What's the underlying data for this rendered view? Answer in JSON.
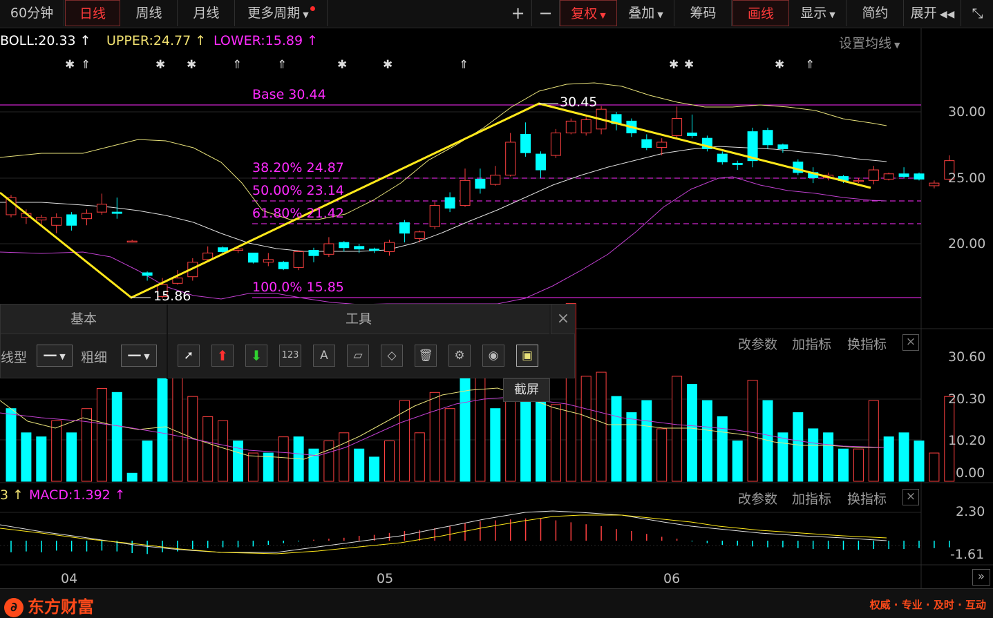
{
  "toolbar": {
    "period_60": "60分钟",
    "period_day": "日线",
    "period_week": "周线",
    "period_month": "月线",
    "more_periods": "更多周期",
    "zoom_in": "+",
    "zoom_out": "−",
    "restore_rights": "复权",
    "overlay": "叠加",
    "chips": "筹码",
    "draw": "画线",
    "display": "显示",
    "simple": "简约",
    "expand": "展开"
  },
  "boll": {
    "boll": "BOLL:20.33",
    "upper": "UPPER:24.77",
    "lower": "LOWER:15.89",
    "setting": "设置均线"
  },
  "annotations": {
    "base": "Base   30.44",
    "fib382": "38.20% 24.87",
    "fib500": "50.00% 23.14",
    "fib618": "61.80% 21.42",
    "fib1000": "100.0% 15.85",
    "high": "30.45",
    "low": "15.86"
  },
  "price_axis": [
    "30.00",
    "25.00",
    "20.00"
  ],
  "volume_axis": [
    "30.60",
    "20.30",
    "10.20",
    "0.00"
  ],
  "macd_axis": [
    "2.30",
    "-1.61"
  ],
  "date_axis": [
    "04",
    "05",
    "06"
  ],
  "panel_actions": {
    "modify": "改参数",
    "add": "加指标",
    "switch": "换指标",
    "close": "×"
  },
  "macd": {
    "left": "3",
    "macd": "MACD:1.392"
  },
  "draw_panel": {
    "tab_basic": "基本",
    "tab_tools": "工具",
    "line_type_label": "线型",
    "thickness_label": "粗细",
    "tool_123": "123",
    "tool_text": "A",
    "close": "×",
    "tooltip": "截屏"
  },
  "footer": {
    "logo": "东方财富",
    "slogan": "权威 · 专业 · 及时 · 互动"
  },
  "colors": {
    "up": "#ff4040",
    "down": "#00ffff",
    "fib": "#ff2bff",
    "trend": "#ffe81a",
    "upper": "#e8e27a",
    "mid": "#e0e0e0",
    "lower": "#c040d0"
  },
  "chart_data": {
    "type": "candlestick",
    "price_scale": {
      "y_top": 30.0,
      "y_bottom": 20.0
    },
    "candles": [
      [
        22.2,
        23.5,
        23.7,
        22.0
      ],
      [
        22.0,
        22.3,
        22.6,
        21.5
      ],
      [
        21.8,
        22.0,
        22.2,
        21.3
      ],
      [
        21.4,
        22.0,
        22.3,
        20.8
      ],
      [
        22.2,
        21.4,
        22.4,
        21.0
      ],
      [
        21.9,
        22.3,
        22.6,
        21.4
      ],
      [
        22.4,
        23.0,
        23.8,
        22.2
      ],
      [
        22.4,
        22.3,
        23.5,
        21.9
      ],
      [
        20.2,
        20.2,
        20.3,
        20.1
      ],
      [
        17.8,
        17.6,
        17.9,
        17.2
      ],
      [
        16.0,
        16.9,
        17.4,
        15.86
      ],
      [
        17.0,
        17.4,
        18.0,
        16.9
      ],
      [
        17.5,
        18.6,
        18.9,
        17.2
      ],
      [
        18.8,
        19.3,
        19.8,
        18.6
      ],
      [
        19.7,
        19.4,
        19.8,
        19.2
      ],
      [
        19.5,
        19.6,
        19.7,
        19.3
      ],
      [
        19.3,
        18.6,
        19.3,
        18.5
      ],
      [
        18.6,
        18.8,
        19.3,
        18.3
      ],
      [
        18.6,
        18.1,
        18.7,
        18.0
      ],
      [
        18.2,
        19.4,
        19.5,
        18.0
      ],
      [
        19.5,
        19.1,
        19.7,
        18.6
      ],
      [
        19.2,
        20.0,
        20.5,
        19.0
      ],
      [
        20.1,
        19.7,
        20.2,
        19.4
      ],
      [
        19.8,
        19.6,
        20.0,
        19.3
      ],
      [
        19.6,
        19.5,
        19.7,
        19.3
      ],
      [
        19.4,
        20.1,
        20.3,
        19.1
      ],
      [
        21.6,
        20.8,
        21.8,
        20.1
      ],
      [
        20.4,
        20.9,
        21.0,
        20.1
      ],
      [
        21.3,
        22.9,
        23.2,
        21.1
      ],
      [
        23.5,
        22.7,
        23.9,
        22.4
      ],
      [
        22.9,
        24.8,
        25.7,
        22.8
      ],
      [
        24.9,
        24.2,
        25.7,
        23.8
      ],
      [
        24.5,
        25.2,
        25.9,
        24.4
      ],
      [
        25.2,
        27.7,
        28.4,
        25.1
      ],
      [
        28.3,
        26.9,
        29.2,
        26.6
      ],
      [
        26.8,
        25.6,
        27.0,
        25.0
      ],
      [
        26.7,
        28.4,
        28.7,
        26.5
      ],
      [
        28.4,
        29.3,
        29.5,
        28.3
      ],
      [
        28.4,
        29.4,
        29.6,
        28.2
      ],
      [
        28.7,
        30.2,
        30.45,
        28.3
      ],
      [
        29.8,
        29.1,
        30.0,
        28.6
      ],
      [
        29.3,
        28.4,
        29.5,
        28.1
      ],
      [
        27.9,
        27.3,
        28.3,
        27.1
      ],
      [
        27.3,
        27.7,
        28.0,
        26.7
      ],
      [
        28.2,
        29.5,
        30.4,
        28.0
      ],
      [
        28.4,
        28.2,
        29.8,
        28.0
      ],
      [
        28.0,
        27.2,
        28.2,
        27.0
      ],
      [
        26.8,
        26.2,
        27.0,
        26.0
      ],
      [
        26.1,
        26.0,
        26.3,
        25.6
      ],
      [
        28.5,
        26.3,
        28.8,
        25.8
      ],
      [
        28.6,
        27.5,
        28.8,
        27.2
      ],
      [
        27.5,
        27.2,
        27.6,
        26.9
      ],
      [
        26.2,
        25.4,
        26.4,
        25.2
      ],
      [
        25.4,
        25.0,
        25.8,
        24.6
      ],
      [
        25.0,
        25.2,
        25.4,
        24.8
      ],
      [
        25.1,
        24.8,
        25.2,
        24.6
      ],
      [
        24.8,
        24.8,
        25.0,
        24.6
      ],
      [
        24.8,
        25.6,
        25.9,
        24.5
      ],
      [
        24.9,
        25.3,
        25.4,
        24.8
      ],
      [
        25.3,
        25.1,
        25.8,
        25.0
      ],
      [
        25.3,
        24.9,
        25.4,
        24.8
      ],
      [
        24.4,
        24.6,
        24.8,
        24.2
      ],
      [
        24.9,
        26.3,
        26.7,
        24.7
      ]
    ],
    "volume": [
      [
        18,
        0
      ],
      [
        12,
        0
      ],
      [
        11,
        0
      ],
      [
        15,
        1
      ],
      [
        12,
        0
      ],
      [
        18,
        1
      ],
      [
        23,
        1
      ],
      [
        22,
        0
      ],
      [
        2,
        0
      ],
      [
        10,
        0
      ],
      [
        33,
        0
      ],
      [
        30,
        1
      ],
      [
        21,
        1
      ],
      [
        16,
        1
      ],
      [
        15,
        1
      ],
      [
        10,
        0
      ],
      [
        7,
        1
      ],
      [
        7,
        0
      ],
      [
        11,
        1
      ],
      [
        11,
        0
      ],
      [
        8,
        0
      ],
      [
        10,
        1
      ],
      [
        12,
        1
      ],
      [
        8,
        0
      ],
      [
        6,
        0
      ],
      [
        10,
        1
      ],
      [
        20,
        1
      ],
      [
        12,
        1
      ],
      [
        22,
        1
      ],
      [
        18,
        1
      ],
      [
        32,
        0
      ],
      [
        31,
        1
      ],
      [
        18,
        0
      ],
      [
        35,
        1
      ],
      [
        43,
        0
      ],
      [
        31,
        0
      ],
      [
        19,
        1
      ],
      [
        44,
        1
      ],
      [
        26,
        1
      ],
      [
        27,
        1
      ],
      [
        21,
        0
      ],
      [
        17,
        0
      ],
      [
        20,
        0
      ],
      [
        13,
        1
      ],
      [
        26,
        1
      ],
      [
        24,
        0
      ],
      [
        20,
        0
      ],
      [
        16,
        0
      ],
      [
        10,
        0
      ],
      [
        25,
        1
      ],
      [
        20,
        0
      ],
      [
        12,
        0
      ],
      [
        17,
        0
      ],
      [
        13,
        0
      ],
      [
        12,
        0
      ],
      [
        8,
        0
      ],
      [
        8,
        1
      ],
      [
        20,
        1
      ],
      [
        11,
        0
      ],
      [
        12,
        0
      ],
      [
        10,
        0
      ],
      [
        7,
        1
      ],
      [
        21,
        1
      ]
    ],
    "macd": [
      -1.4,
      -1.3,
      -1.4,
      -1.2,
      -1.3,
      -1.3,
      -1.2,
      -1.3,
      -1.5,
      -1.61,
      -1.4,
      -1.3,
      -1.0,
      -0.9,
      -0.8,
      -0.8,
      -0.7,
      -0.5,
      -0.3,
      -0.1,
      0.1,
      0.2,
      0.3,
      0.5,
      0.6,
      0.8,
      1.0,
      1.1,
      1.3,
      1.5,
      1.8,
      2.0,
      2.1,
      2.2,
      2.3,
      2.3,
      2.1,
      1.9,
      1.7,
      1.5,
      1.2,
      1.0,
      0.7,
      0.4,
      0.2,
      -0.1,
      -0.3,
      -0.5,
      -0.6,
      -0.7,
      -0.8,
      -0.8,
      -0.9,
      -1.0,
      -1.0,
      -1.1,
      -1.1,
      -1.0,
      -1.0,
      -1.0,
      -0.9,
      -0.9,
      -0.8
    ]
  }
}
